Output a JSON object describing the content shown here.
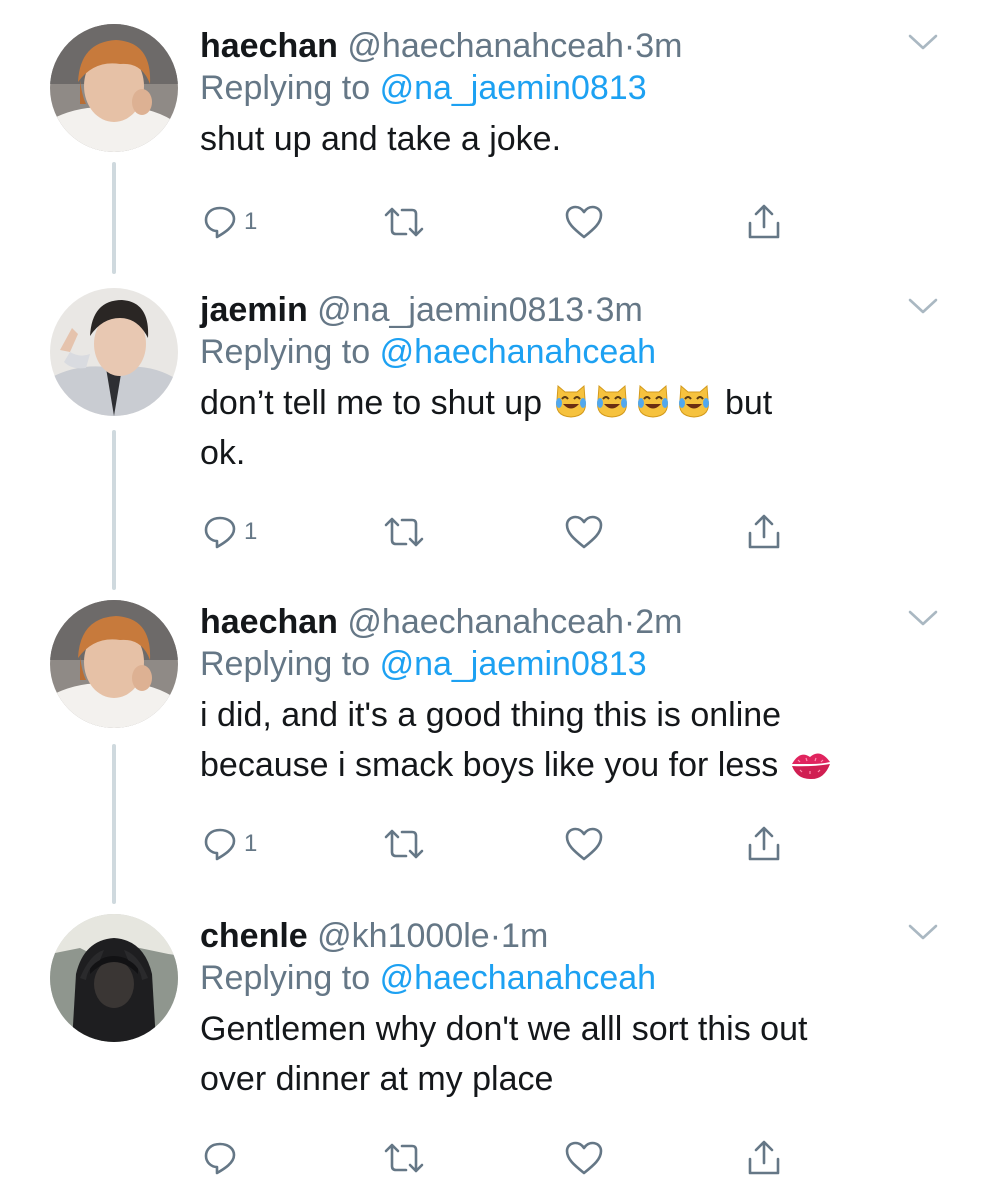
{
  "colors": {
    "name": "#14171a",
    "muted": "#657786",
    "link": "#1da1f2",
    "thread_line": "#cfd9de"
  },
  "tweets": [
    {
      "name": "haechan",
      "handle": "@haechanahceah",
      "dot": "·",
      "time": "3m",
      "replying_label": "Replying to",
      "replying_to": "@na_jaemin0813",
      "text_parts": [
        "shut up and take a joke."
      ],
      "reply_count": "1",
      "emoji": []
    },
    {
      "name": "jaemin",
      "handle": "@na_jaemin0813",
      "dot": "·",
      "time": "3m",
      "replying_label": "Replying to",
      "replying_to": "@haechanahceah",
      "text_parts": [
        "don’t tell me to shut up ",
        " but\nok."
      ],
      "reply_count": "1",
      "emoji": [
        "cat-tears-of-joy",
        "cat-tears-of-joy",
        "cat-tears-of-joy",
        "cat-tears-of-joy"
      ]
    },
    {
      "name": "haechan",
      "handle": "@haechanahceah",
      "dot": "·",
      "time": "2m",
      "replying_label": "Replying to",
      "replying_to": "@na_jaemin0813",
      "text_parts": [
        "i did, and it's a good thing this is online\nbecause i smack boys like you for less "
      ],
      "reply_count": "1",
      "emoji": [
        "kiss-mark"
      ]
    },
    {
      "name": "chenle",
      "handle": "@kh1000le",
      "dot": "·",
      "time": "1m",
      "replying_label": "Replying to",
      "replying_to": "@haechanahceah",
      "text_parts": [
        "Gentlemen why don't we alll sort this out\nover dinner at my place"
      ],
      "reply_count": "",
      "emoji": []
    }
  ],
  "icons": {
    "reply": "reply-icon",
    "retweet": "retweet-icon",
    "like": "heart-icon",
    "share": "share-icon",
    "more": "chevron-down-icon"
  }
}
